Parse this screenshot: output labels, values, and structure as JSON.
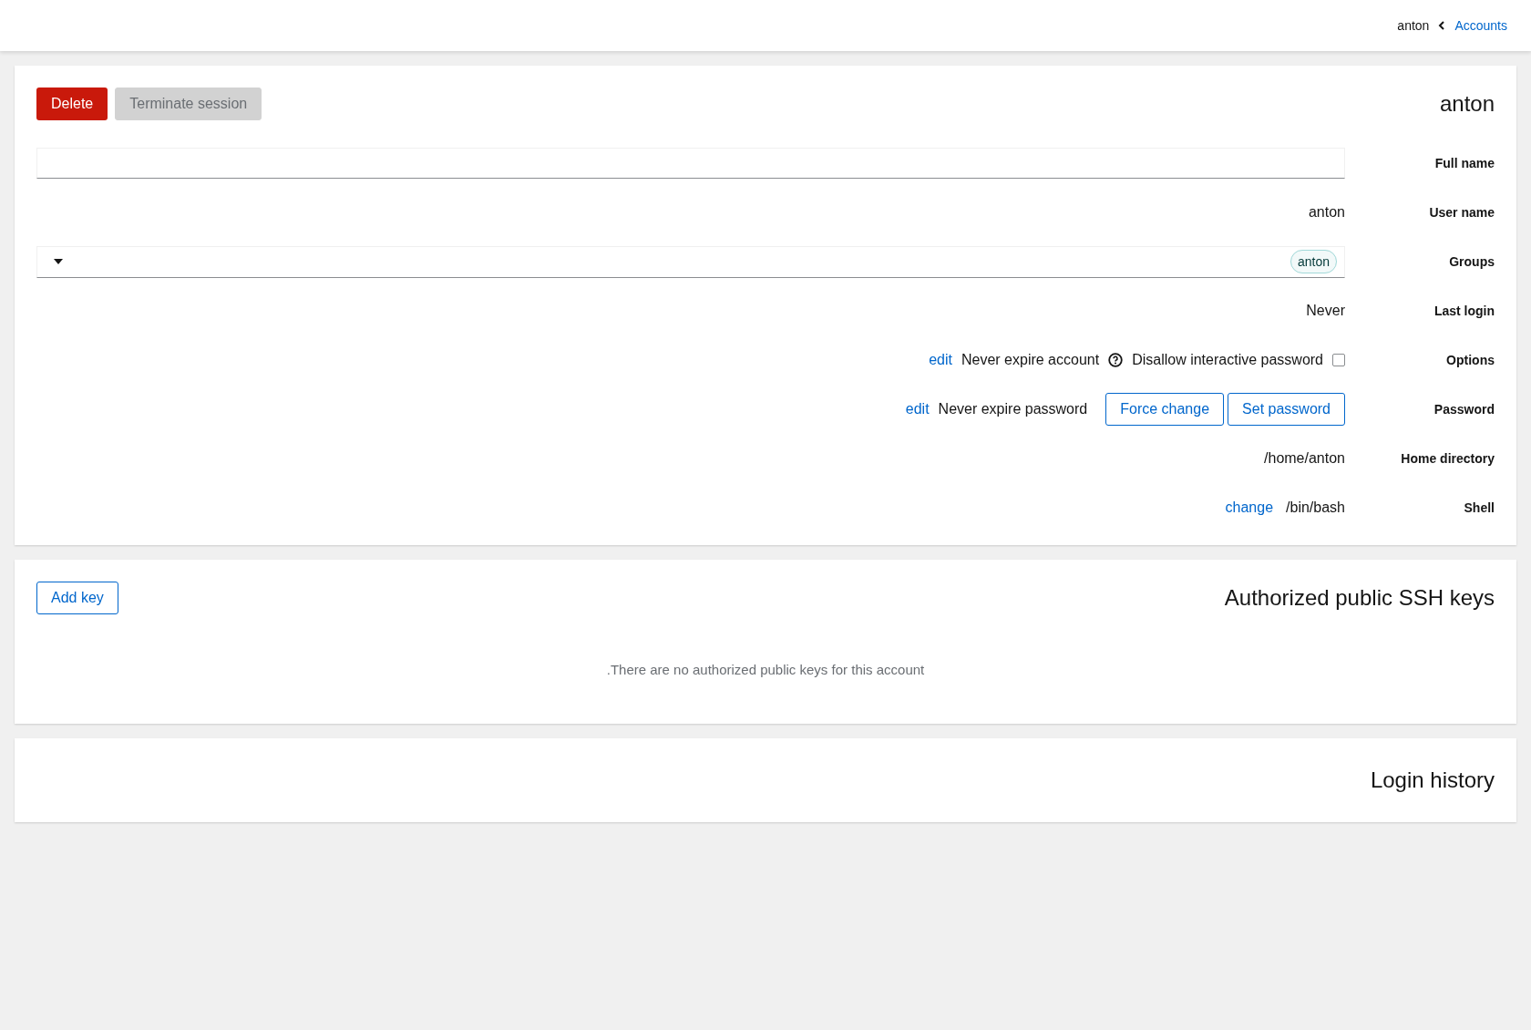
{
  "breadcrumb": {
    "current": "anton",
    "link": "Accounts"
  },
  "account": {
    "title": "anton",
    "buttons": [
      {
        "label": "Delete",
        "kind": "danger",
        "disabled": false
      },
      {
        "label": "Terminate session",
        "kind": "secondary",
        "disabled": true
      }
    ],
    "fields": [
      {
        "kind": "input",
        "label": "Full name"
      },
      {
        "kind": "text",
        "label": "User name",
        "value": "anton"
      },
      {
        "kind": "groups",
        "label": "Groups",
        "chips": [
          "anton"
        ]
      },
      {
        "kind": "text",
        "label": "Last login",
        "value": "Never"
      },
      {
        "kind": "options",
        "label": "Options",
        "link": "edit",
        "text": "Never expire account",
        "checkbox_label": "Disallow interactive password",
        "checked": false
      },
      {
        "kind": "password",
        "label": "Password",
        "link": "edit",
        "text": "Never expire password",
        "buttons": [
          "Force change",
          "Set password"
        ]
      },
      {
        "kind": "text",
        "label": "Home directory",
        "value": "/home/anton"
      },
      {
        "kind": "shell",
        "label": "Shell",
        "link": "change",
        "value": "/bin/bash"
      }
    ]
  },
  "ssh_keys": {
    "title": "Authorized public SSH keys",
    "button": "Add key",
    "empty_text": ".There are no authorized public keys for this account"
  },
  "login_history": {
    "title": "Login history"
  }
}
